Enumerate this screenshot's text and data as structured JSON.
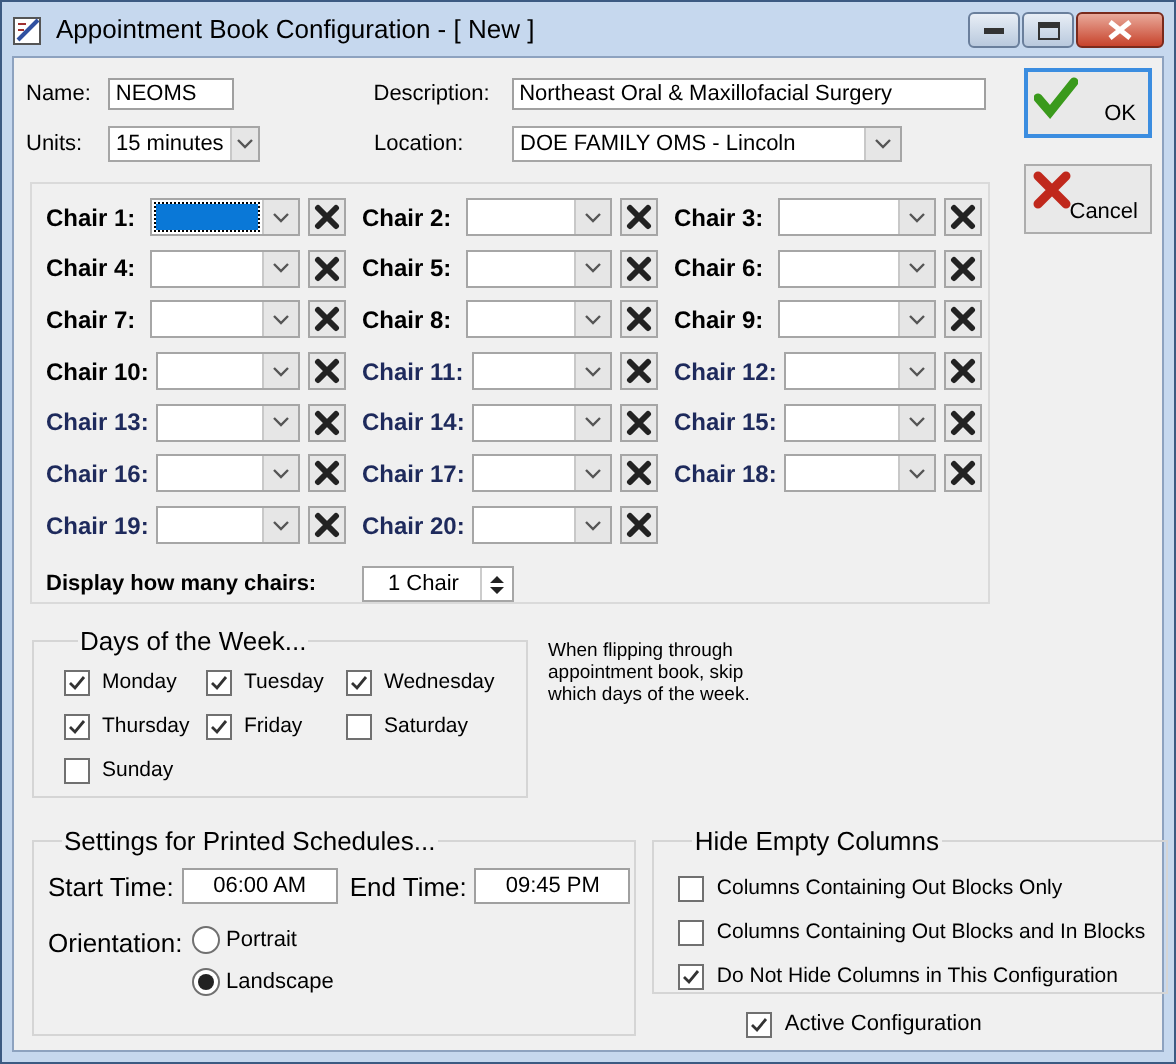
{
  "window": {
    "title": "Appointment Book Configuration - [ New ]"
  },
  "fields": {
    "name": {
      "label": "Name:",
      "value": "NEOMS"
    },
    "description": {
      "label": "Description:",
      "value": "Northeast Oral & Maxillofacial Surgery"
    },
    "units": {
      "label": "Units:",
      "value": "15 minutes"
    },
    "location": {
      "label": "Location:",
      "value": "DOE FAMILY OMS - Lincoln"
    }
  },
  "buttons": [
    {
      "label": "OK",
      "kind": "ok"
    },
    {
      "label": "Cancel",
      "kind": "cancel"
    }
  ],
  "chairs": [
    {
      "label": "Chair 1:",
      "focused": true
    },
    {
      "label": "Chair 2:",
      "focused": false
    },
    {
      "label": "Chair 3:",
      "focused": false
    },
    {
      "label": "Chair 4:",
      "focused": false
    },
    {
      "label": "Chair 5:",
      "focused": false
    },
    {
      "label": "Chair 6:",
      "focused": false
    },
    {
      "label": "Chair 7:",
      "focused": false
    },
    {
      "label": "Chair 8:",
      "focused": false
    },
    {
      "label": "Chair 9:",
      "focused": false
    },
    {
      "label": "Chair 10:",
      "focused": false
    },
    {
      "label": "Chair 11:",
      "focused": false
    },
    {
      "label": "Chair 12:",
      "focused": false
    },
    {
      "label": "Chair 13:",
      "focused": false
    },
    {
      "label": "Chair 14:",
      "focused": false
    },
    {
      "label": "Chair 15:",
      "focused": false
    },
    {
      "label": "Chair 16:",
      "focused": false
    },
    {
      "label": "Chair 17:",
      "focused": false
    },
    {
      "label": "Chair 18:",
      "focused": false
    },
    {
      "label": "Chair 19:",
      "focused": false
    },
    {
      "label": "Chair 20:",
      "focused": false
    }
  ],
  "display_chairs": {
    "label": "Display how many chairs:",
    "value": "1 Chair"
  },
  "days": {
    "title": "Days of the Week...",
    "items": [
      {
        "label": "Monday",
        "checked": true
      },
      {
        "label": "Tuesday",
        "checked": true
      },
      {
        "label": "Wednesday",
        "checked": true
      },
      {
        "label": "Thursday",
        "checked": true
      },
      {
        "label": "Friday",
        "checked": true
      },
      {
        "label": "Saturday",
        "checked": false
      },
      {
        "label": "Sunday",
        "checked": false
      }
    ]
  },
  "days_note": "When flipping through appointment book, skip which days of the week.",
  "print_settings": {
    "title": "Settings for Printed Schedules...",
    "start_time": {
      "label": "Start Time:",
      "value": "06:00 AM"
    },
    "end_time": {
      "label": "End Time:",
      "value": "09:45 PM"
    },
    "orientation": {
      "label": "Orientation:",
      "options": [
        {
          "label": "Portrait",
          "selected": false
        },
        {
          "label": "Landscape",
          "selected": true
        }
      ]
    }
  },
  "hide_empty_columns": {
    "title": "Hide Empty Columns",
    "options": [
      {
        "label": "Columns Containing Out Blocks Only",
        "checked": false
      },
      {
        "label": "Columns Containing Out Blocks and In Blocks",
        "checked": false
      },
      {
        "label": "Do Not Hide Columns in This Configuration",
        "checked": true
      }
    ]
  },
  "active_configuration": {
    "label": "Active Configuration",
    "checked": true
  }
}
